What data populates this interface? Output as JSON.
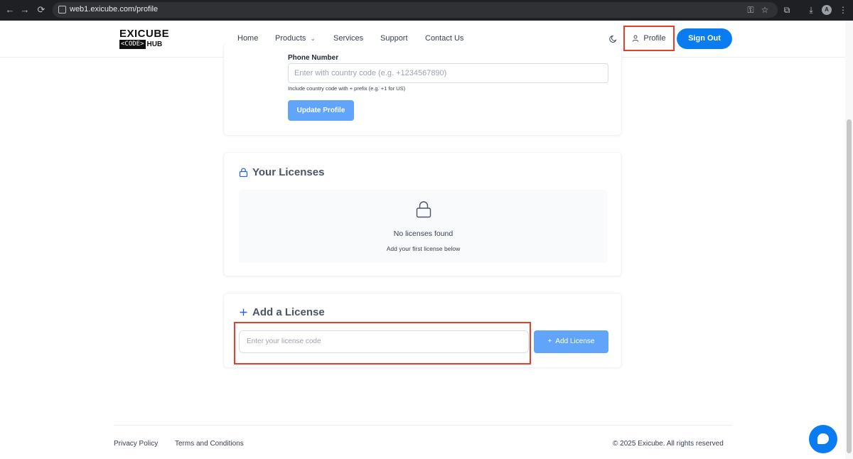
{
  "browser": {
    "url": "web1.exicube.com/profile",
    "avatar_letter": "A"
  },
  "header": {
    "logo": {
      "line1": "EXICUBE",
      "code": "<CODE>",
      "hub": "HUB"
    },
    "nav": [
      {
        "label": "Home"
      },
      {
        "label": "Products"
      },
      {
        "label": "Services"
      },
      {
        "label": "Support"
      },
      {
        "label": "Contact Us"
      }
    ],
    "profile_label": "Profile",
    "signout_label": "Sign Out"
  },
  "profile_form": {
    "phone_label": "Phone Number",
    "phone_placeholder": "Enter with country code (e.g. +1234567890)",
    "phone_hint": "Include country code with + prefix (e.g. +1 for US)",
    "update_label": "Update Profile"
  },
  "licenses": {
    "title": "Your Licenses",
    "empty_title": "No licenses found",
    "empty_sub": "Add your first license below"
  },
  "add_license": {
    "title": "Add a License",
    "placeholder": "Enter your license code",
    "button_label": "Add License"
  },
  "footer": {
    "privacy": "Privacy Policy",
    "terms": "Terms and Conditions",
    "copyright": "© 2025 Exicube. All rights reserved"
  },
  "colors": {
    "primary": "#0a7cf1",
    "primary_light": "#60a5fa",
    "highlight": "#e53e2c"
  }
}
